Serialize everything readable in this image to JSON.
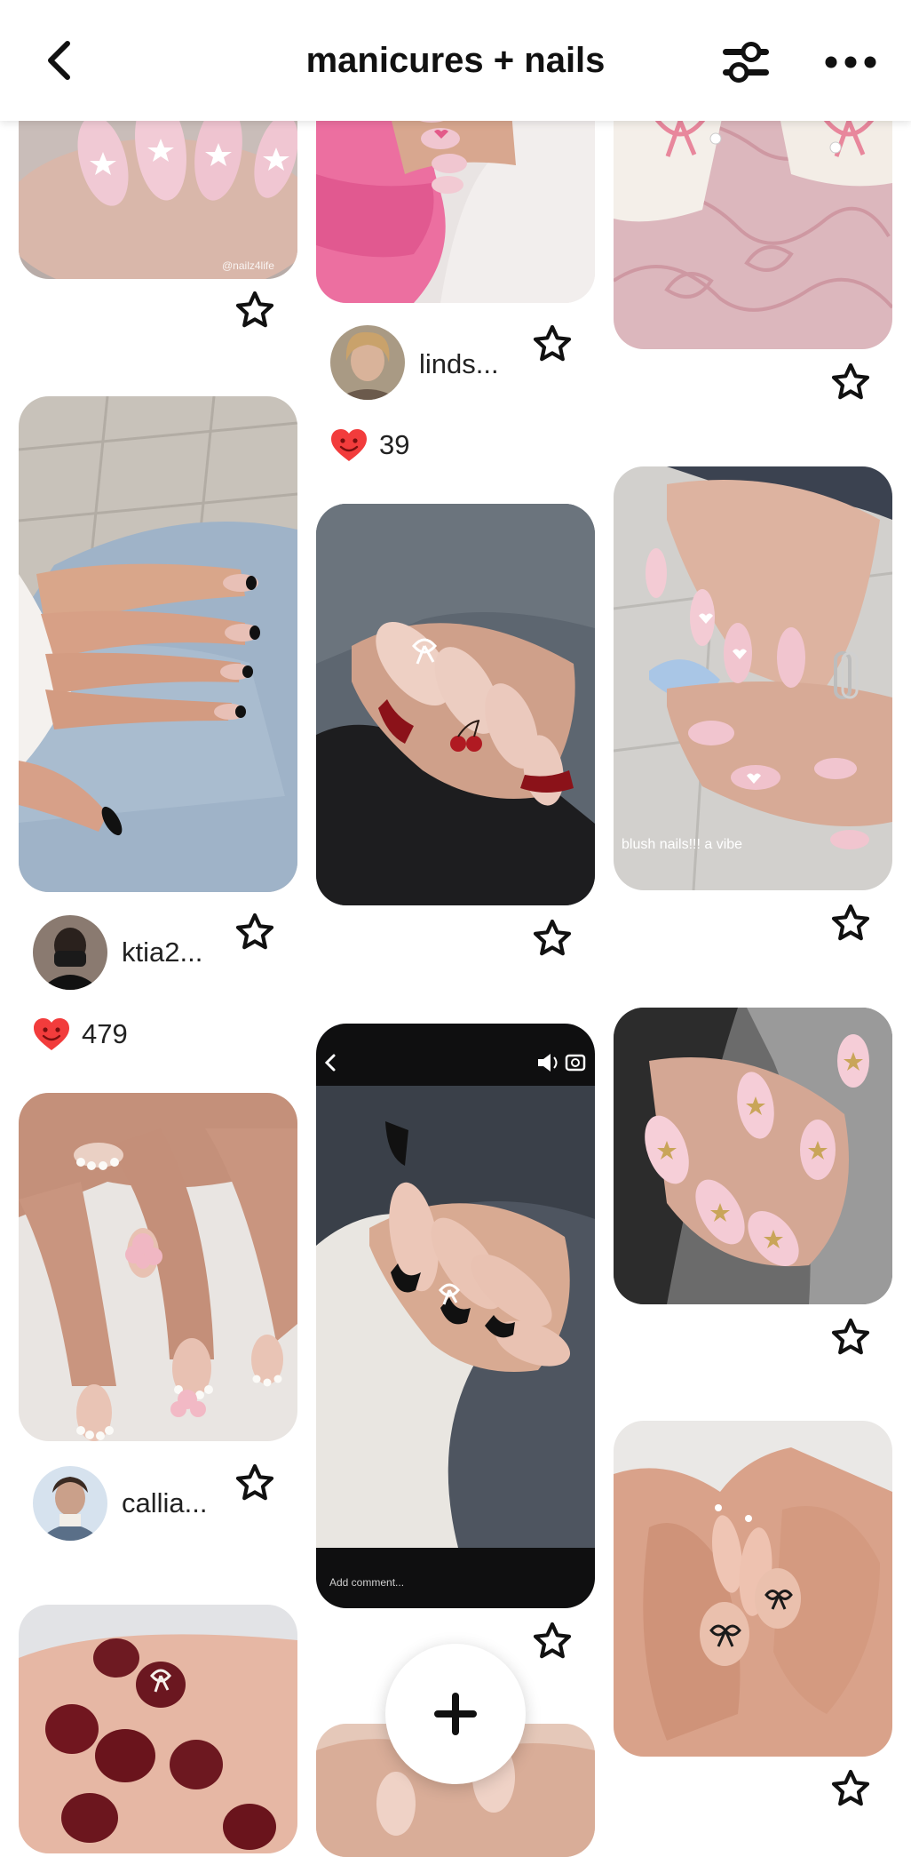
{
  "header": {
    "title": "manicures + nails",
    "back_icon": "chevron-left-icon",
    "filter_icon": "sliders-icon",
    "more_icon": "ellipsis-icon"
  },
  "pins": [
    {
      "id": "col1-pin1",
      "description": "pink almond nails with white stars"
    },
    {
      "id": "col1-pin2",
      "description": "black french tip almond nails"
    },
    {
      "id": "col1-pin3",
      "description": "pearl french tips with pink bow"
    },
    {
      "id": "col1-pin4",
      "description": "dark red nails with white bow"
    },
    {
      "id": "col2-pin1",
      "description": "pink sweater with nails"
    },
    {
      "id": "col2-pin2",
      "description": "red french tips with cherries and bow"
    },
    {
      "id": "col2-pin3",
      "description": "black french tips with bow, video"
    },
    {
      "id": "col2-pin4",
      "description": "nails peeking"
    },
    {
      "id": "col3-pin1",
      "description": "white square nails with pink bows"
    },
    {
      "id": "col3-pin2",
      "description": "blush nails with hearts and bows"
    },
    {
      "id": "col3-pin3",
      "description": "pink nails with gold stars"
    },
    {
      "id": "col3-pin4",
      "description": "nude nails with black bow art"
    }
  ],
  "overlays": {
    "col1_pin1_watermark": "@nailz4life",
    "col3_pin2_caption": "blush nails!!! a vibe",
    "col2_pin3_comment_placeholder": "Add comment..."
  },
  "users": [
    {
      "username": "linds...",
      "likes": "39"
    },
    {
      "username": "ktia2...",
      "likes": "479"
    },
    {
      "username": "callia..."
    }
  ],
  "fab_icon": "plus-icon",
  "colors": {
    "heart": "#f23c3c",
    "header_bg": "#ffffff",
    "text": "#111111"
  }
}
